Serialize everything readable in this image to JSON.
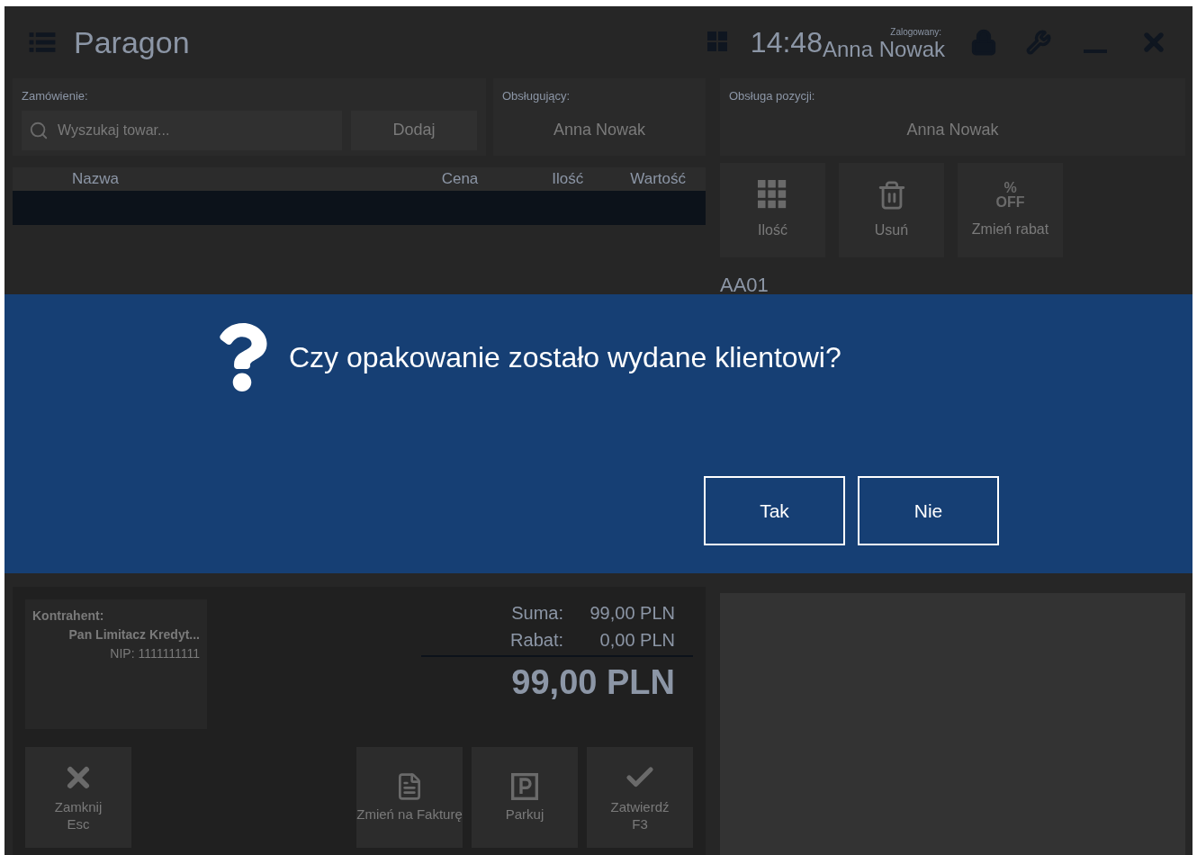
{
  "window": {
    "title": "Paragon",
    "time": "14:48",
    "logged_in_label": "Zalogowany:",
    "user": "Anna Nowak"
  },
  "order": {
    "label": "Zamówienie:",
    "search_placeholder": "Wyszukaj towar...",
    "add_button": "Dodaj"
  },
  "cashier": {
    "label": "Obsługujący:",
    "value": "Anna Nowak"
  },
  "table": {
    "columns": [
      "Nazwa",
      "Cena",
      "Ilość",
      "Wartość"
    ],
    "rows": [
      {
        "selected": true
      }
    ]
  },
  "item_handling": {
    "label": "Obsługa pozycji:",
    "value": "Anna Nowak"
  },
  "item_actions": [
    {
      "kind": "quantity",
      "label": "Ilość"
    },
    {
      "kind": "delete",
      "label": "Usuń"
    },
    {
      "kind": "discount",
      "label": "Zmień rabat",
      "icon_top": "%",
      "icon_bottom": "OFF"
    }
  ],
  "item_code": "AA01",
  "customer": {
    "label": "Kontrahent:",
    "name": "Pan Limitacz Kredyt...",
    "nip": "NIP: 1111111111"
  },
  "totals": {
    "sum_label": "Suma:",
    "sum": "99,00 PLN",
    "discount_label": "Rabat:",
    "discount": "0,00 PLN",
    "total": "99,00 PLN"
  },
  "footer_actions": [
    {
      "kind": "close",
      "label": "Zamknij",
      "shortcut": "Esc"
    },
    {
      "kind": "invoice",
      "label": "Zmień na Fakturę"
    },
    {
      "kind": "park",
      "label": "Parkuj"
    },
    {
      "kind": "confirm",
      "label": "Zatwierdź",
      "shortcut": "F3"
    }
  ],
  "dialog": {
    "message": "Czy opakowanie zostało wydane klientowi?",
    "buttons": [
      "Tak",
      "Nie"
    ]
  }
}
